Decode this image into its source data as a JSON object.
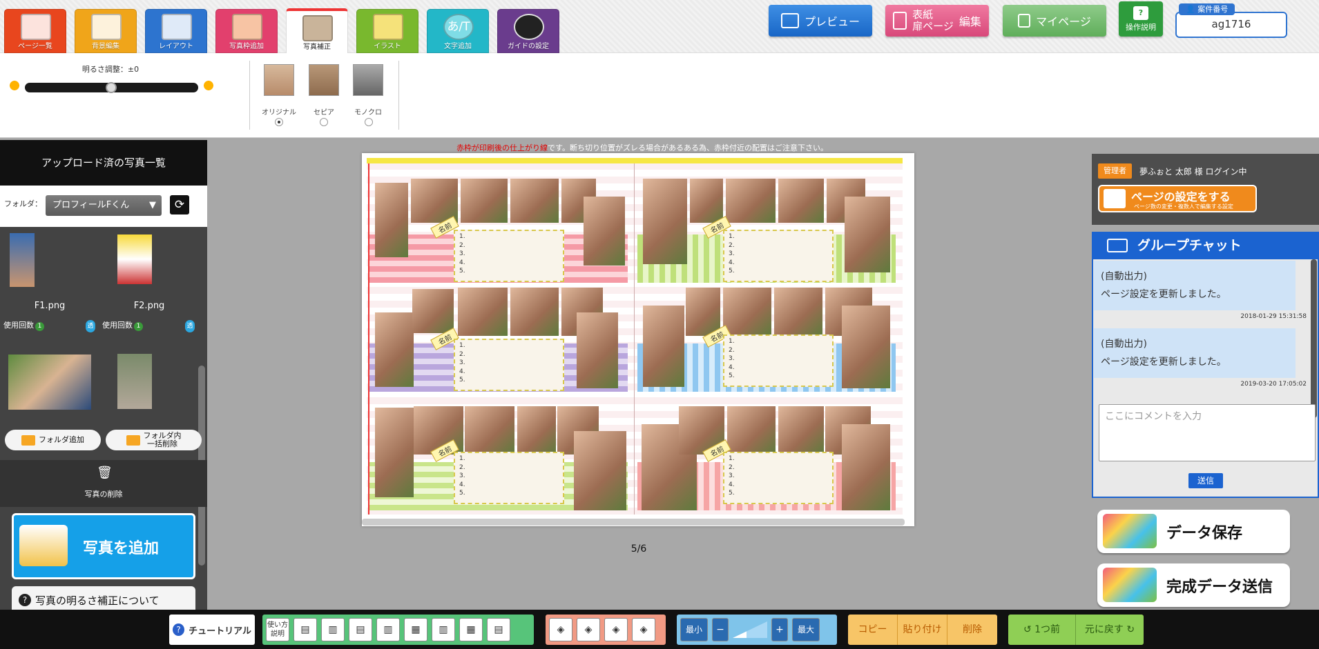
{
  "tools": [
    {
      "label": "ページ一覧",
      "color": "#e8461e"
    },
    {
      "label": "背景編集",
      "color": "#f0a51a"
    },
    {
      "label": "レイアウト",
      "color": "#2d74cf"
    },
    {
      "label": "写真枠追加",
      "color": "#e2406d"
    },
    {
      "label": "写真補正",
      "color": "#ffffff"
    },
    {
      "label": "イラスト",
      "color": "#79b82e"
    },
    {
      "label": "文字追加",
      "color": "#23b7c8"
    },
    {
      "label": "ガイドの設定",
      "color": "#6a3c8d"
    }
  ],
  "header": {
    "preview_label": "プレビュー",
    "cover_line1": "表紙",
    "cover_line2": "扉ページ",
    "cover_edit": "編集",
    "mypage_label": "マイページ",
    "help_label": "操作説明",
    "case_label": "案件番号",
    "case_value": "ag1716"
  },
  "adjust": {
    "brightness_label": "明るさ調整：±0",
    "brightness_value": 0,
    "filters": [
      {
        "label": "オリジナル",
        "selected": true
      },
      {
        "label": "セピア",
        "selected": false
      },
      {
        "label": "モノクロ",
        "selected": false
      }
    ]
  },
  "sidebar": {
    "title": "アップロード済の写真一覧",
    "folder_label": "フォルダ：",
    "folder_value": "プロフィールFくん",
    "photos": [
      {
        "name": "F1.png",
        "use_label": "使用回数",
        "use_count": "1",
        "trans": "透"
      },
      {
        "name": "F2.png",
        "use_label": "使用回数",
        "use_count": "1",
        "trans": "透"
      }
    ],
    "folder_add": "フォルダ追加",
    "folder_delete_line1": "フォルダ内",
    "folder_delete_line2": "一括削除",
    "delete_photo": "写真の削除",
    "add_photo": "写真を追加",
    "help_brightness": "写真の明るさ補正について"
  },
  "canvas": {
    "warning_red": "赤枠が印刷後の仕上がり線",
    "warning_rest": "です。断ち切り位置がズレる場合があるある為、赤枠付近の配置はご注意下さい。",
    "name_label": "名前",
    "list_items": [
      "1.",
      "2.",
      "3.",
      "4.",
      "5."
    ],
    "page_indicator": "5/6"
  },
  "right": {
    "admin_tag": "管理者",
    "login_text": "夢ふぉと 太郎 様 ログイン中",
    "page_setting_title": "ページの設定をする",
    "page_setting_sub": "ページ数の変更・複数人で編集する設定",
    "chat_title": "グループチャット",
    "messages": [
      {
        "line1": "(自動出力)",
        "line2": "ページ設定を更新しました。",
        "time": "2018-01-29 15:31:58"
      },
      {
        "line1": "(自動出力)",
        "line2": "ページ設定を更新しました。",
        "time": "2019-03-20 17:05:02"
      }
    ],
    "comment_placeholder": "ここにコメントを入力",
    "send_label": "送信",
    "save_label": "データ保存",
    "submit_label": "完成データ送信"
  },
  "bottom": {
    "tutorial": "チュートリアル",
    "usage_line1": "使い方",
    "usage_line2": "説明",
    "zoom_min": "最小",
    "zoom_max": "最大",
    "copy": "コピー",
    "paste": "貼り付け",
    "delete": "削除",
    "undo": "1つ前",
    "redo": "元に戻す"
  }
}
